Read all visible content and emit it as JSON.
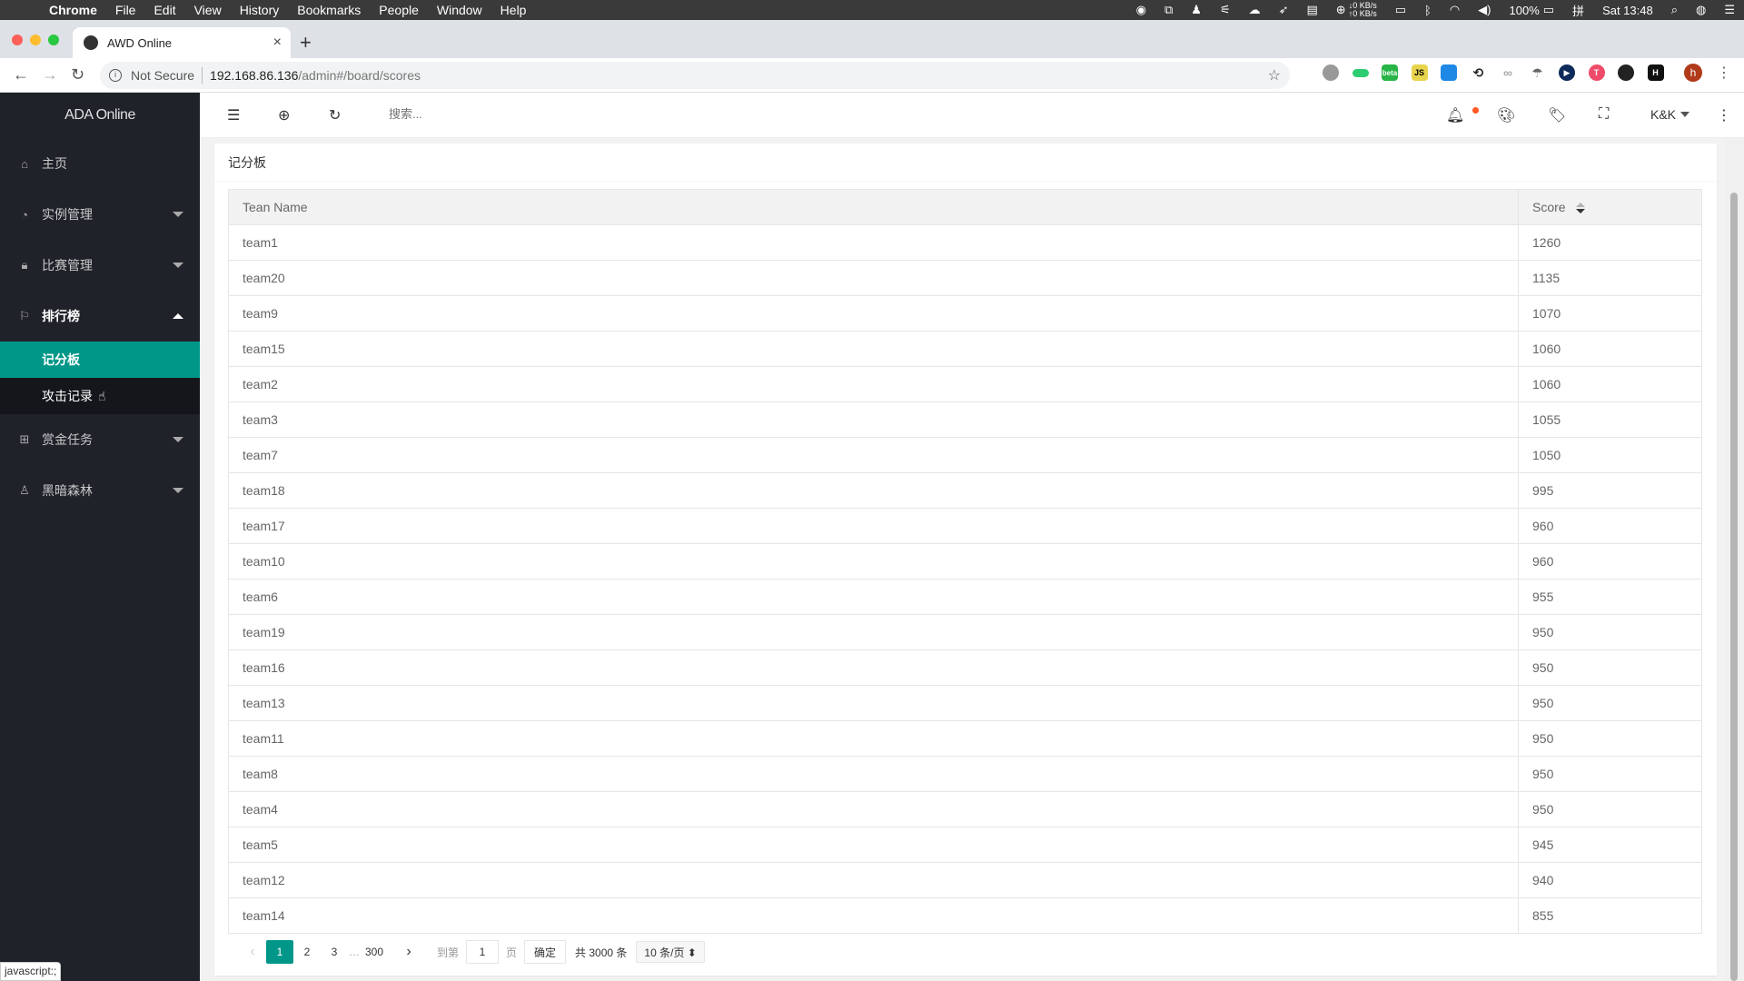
{
  "menubar": {
    "app": "Chrome",
    "items": [
      "File",
      "Edit",
      "View",
      "History",
      "Bookmarks",
      "People",
      "Window",
      "Help"
    ],
    "net_down": "↓0 KB/s",
    "net_up": "↑0 KB/s",
    "battery": "100%",
    "input_method": "拼",
    "clock": "Sat 13:48"
  },
  "browser": {
    "tab_title": "AWD Online",
    "new_tab": "+",
    "security": "Not Secure",
    "url_host": "192.168.86.136",
    "url_path": "/admin#/board/scores",
    "profile_initial": "h",
    "ext_beta": "beta",
    "ext_js": "JS",
    "ext_h": "H",
    "status_url": "javascript:;"
  },
  "sidebar": {
    "logo": "ADA Online",
    "items": [
      {
        "label": "主页",
        "icon": "home-icon"
      },
      {
        "label": "实例管理",
        "icon": "dashboard-icon"
      },
      {
        "label": "比赛管理",
        "icon": "lock-icon"
      },
      {
        "label": "排行榜",
        "icon": "flag-icon",
        "open": true
      },
      {
        "label": "赏金任务",
        "icon": "apps-icon"
      },
      {
        "label": "黑暗森林",
        "icon": "user-icon"
      }
    ],
    "sub_items": [
      {
        "label": "记分板",
        "active": true
      },
      {
        "label": "攻击记录"
      }
    ]
  },
  "header": {
    "search_placeholder": "搜索...",
    "user": "K&K"
  },
  "card": {
    "title": "记分板",
    "columns": [
      "Tean Name",
      "Score"
    ],
    "rows": [
      {
        "team": "team1",
        "score": "1260"
      },
      {
        "team": "team20",
        "score": "1135"
      },
      {
        "team": "team9",
        "score": "1070"
      },
      {
        "team": "team15",
        "score": "1060"
      },
      {
        "team": "team2",
        "score": "1060"
      },
      {
        "team": "team3",
        "score": "1055"
      },
      {
        "team": "team7",
        "score": "1050"
      },
      {
        "team": "team18",
        "score": "995"
      },
      {
        "team": "team17",
        "score": "960"
      },
      {
        "team": "team10",
        "score": "960"
      },
      {
        "team": "team6",
        "score": "955"
      },
      {
        "team": "team19",
        "score": "950"
      },
      {
        "team": "team16",
        "score": "950"
      },
      {
        "team": "team13",
        "score": "950"
      },
      {
        "team": "team11",
        "score": "950"
      },
      {
        "team": "team8",
        "score": "950"
      },
      {
        "team": "team4",
        "score": "950"
      },
      {
        "team": "team5",
        "score": "945"
      },
      {
        "team": "team12",
        "score": "940"
      },
      {
        "team": "team14",
        "score": "855"
      }
    ]
  },
  "pagination": {
    "prev": "‹",
    "pages": [
      "1",
      "2",
      "3"
    ],
    "ellipsis": "…",
    "last": "300",
    "next": "›",
    "goto_label": "到第",
    "goto_value": "1",
    "page_unit": "页",
    "confirm": "确定",
    "total": "共 3000 条",
    "per_page": "10 条/页 ⬍"
  },
  "colors": {
    "accent": "#009688",
    "sidebar_bg": "#20222a",
    "notify_dot": "#ff5722"
  }
}
